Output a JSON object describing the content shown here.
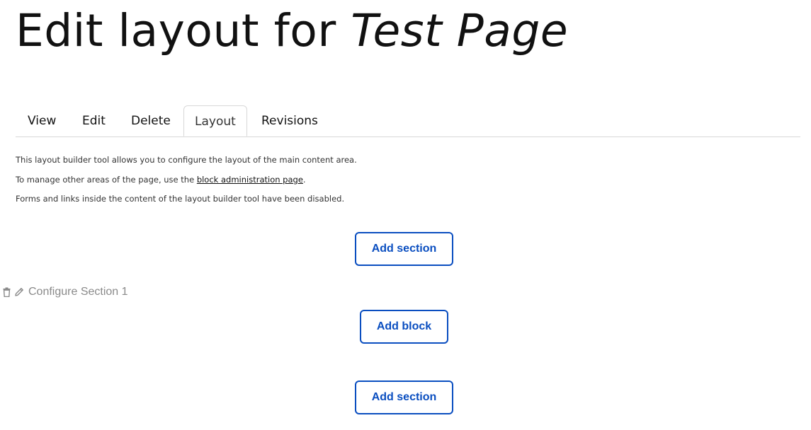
{
  "header": {
    "title_prefix": "Edit layout for",
    "title_entity": "Test Page"
  },
  "tabs": [
    {
      "label": "View",
      "active": false
    },
    {
      "label": "Edit",
      "active": false
    },
    {
      "label": "Delete",
      "active": false
    },
    {
      "label": "Layout",
      "active": true
    },
    {
      "label": "Revisions",
      "active": false
    }
  ],
  "help": {
    "line1": "This layout builder tool allows you to configure the layout of the main content area.",
    "line2_before": "To manage other areas of the page, use the ",
    "line2_link": "block administration page",
    "line2_after": ".",
    "line3": "Forms and links inside the content of the layout builder tool have been disabled."
  },
  "layout_builder": {
    "add_section_top": "Add section",
    "section_1": {
      "remove_icon": "trash-icon",
      "configure_icon": "pencil-icon",
      "configure_label": "Configure Section 1",
      "add_block": "Add block"
    },
    "add_section_bottom": "Add section"
  },
  "colors": {
    "accent": "#0a4ec0",
    "muted": "#8a8a8a",
    "border": "#d8d8d8",
    "text": "#111111"
  }
}
